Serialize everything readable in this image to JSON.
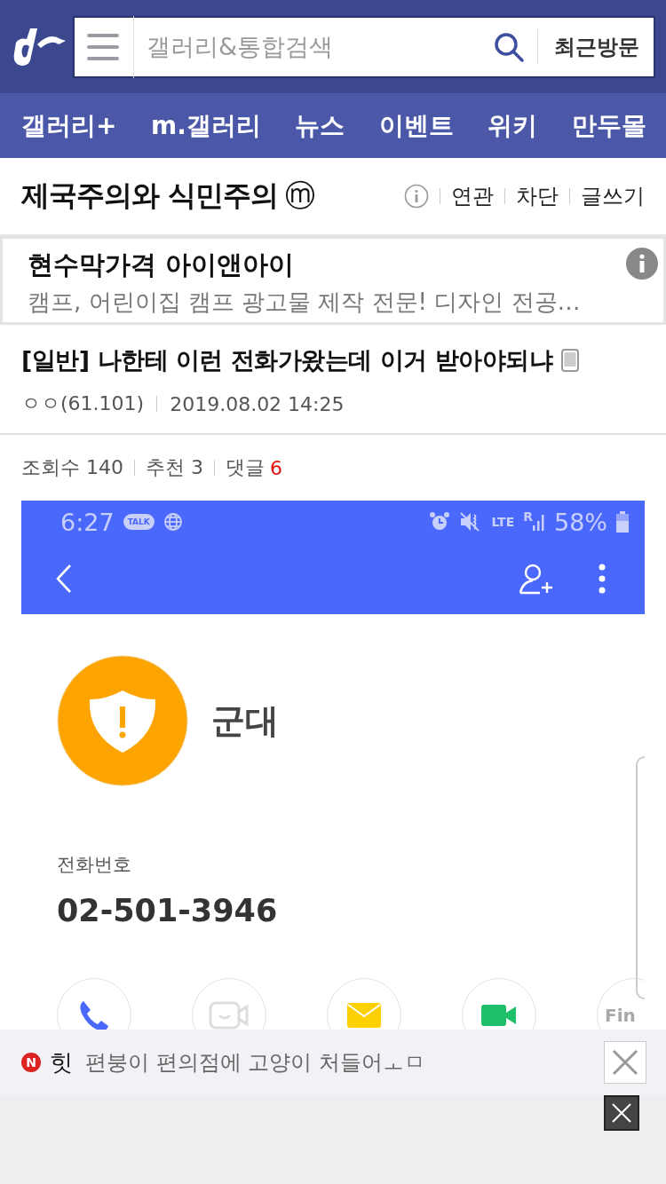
{
  "header": {
    "search": {
      "placeholder": "갤러리&통합검색"
    },
    "recent_button": "최근방문"
  },
  "nav": [
    {
      "label": "갤러리+"
    },
    {
      "label": "m.갤러리"
    },
    {
      "label": "뉴스"
    },
    {
      "label": "이벤트"
    },
    {
      "label": "위키"
    },
    {
      "label": "만두몰"
    }
  ],
  "gallery": {
    "title": "제국주의와 식민주의",
    "badge": "ⓜ",
    "actions": [
      "연관",
      "차단",
      "글쓰기"
    ]
  },
  "ad": {
    "title": "현수막가격 아이앤아이",
    "text": "캠프, 어린이집 캠프 광고물 제작 전문! 디자인 전공…"
  },
  "post": {
    "title": "[일반] 나한테 이런 전화가왔는데 이거 받아야되냐",
    "author": "ㅇㅇ(61.101)",
    "date": "2019.08.02 14:25",
    "views_label": "조회수",
    "views": "140",
    "likes_label": "추천",
    "likes": "3",
    "comments_label": "댓글",
    "comments": "6"
  },
  "screenshot": {
    "time": "6:27",
    "talk": "TALK",
    "lte": "LTE",
    "roaming": "R",
    "battery": "58%",
    "contact_name": "군대",
    "phone_label": "전화번호",
    "phone": "02-501-3946",
    "actions": [
      {
        "kind": "call"
      },
      {
        "kind": "face"
      },
      {
        "kind": "message"
      },
      {
        "kind": "video"
      },
      {
        "kind": "finn",
        "text": "Fin"
      }
    ]
  },
  "hit_bar": {
    "badge": "N",
    "label": "힛",
    "text": "편붕이 편의점에 고양이 처들어ㅗㅁ"
  }
}
